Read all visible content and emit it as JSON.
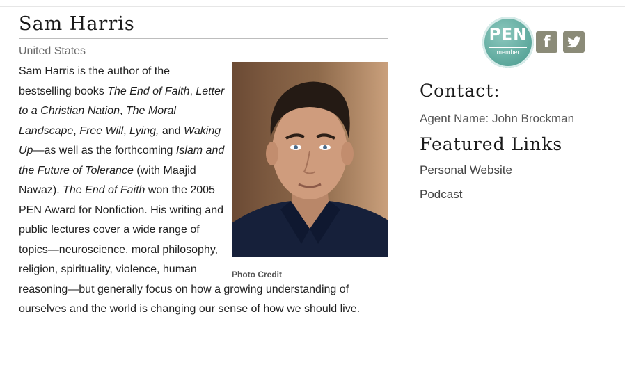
{
  "profile": {
    "name": "Sam Harris",
    "country": "United States",
    "photo_caption": "Photo Credit",
    "bio": [
      {
        "text": "Sam Harris is the author of the bestselling books ",
        "italic": false
      },
      {
        "text": "The End of Faith",
        "italic": true
      },
      {
        "text": ", ",
        "italic": false
      },
      {
        "text": "Letter to a Christian Nation",
        "italic": true
      },
      {
        "text": ", ",
        "italic": false
      },
      {
        "text": "The Moral Landscape",
        "italic": true
      },
      {
        "text": ", ",
        "italic": false
      },
      {
        "text": "Free Will",
        "italic": true
      },
      {
        "text": ", ",
        "italic": false
      },
      {
        "text": "Lying,",
        "italic": true
      },
      {
        "text": " and ",
        "italic": false
      },
      {
        "text": "Waking Up",
        "italic": true
      },
      {
        "text": "—as well as the forthcoming ",
        "italic": false
      },
      {
        "text": "Islam and the Future of Tolerance",
        "italic": true
      },
      {
        "text": " (with Maajid Nawaz). ",
        "italic": false
      },
      {
        "text": "The End of Faith",
        "italic": true
      },
      {
        "text": " won the 2005 PEN Award for Nonfiction. His writing and public lectures cover a wide range of topics—neuroscience, moral philosophy, religion, spirituality, violence, human reasoning—but generally focus on how a growing understanding of ourselves and the world is changing our sense of how we should live.",
        "italic": false
      }
    ]
  },
  "badges": {
    "pen_label": "PEN",
    "pen_sublabel": "member",
    "facebook_glyph": "f",
    "icons": [
      "pen-member-badge",
      "facebook-icon",
      "twitter-icon"
    ],
    "badge_color": "#5aa69a",
    "social_color": "#8b8b78"
  },
  "sidebar": {
    "contact_heading": "Contact:",
    "agent": "Agent Name: John Brockman",
    "featured_heading": "Featured Links",
    "links": [
      "Personal Website",
      "Podcast"
    ]
  }
}
